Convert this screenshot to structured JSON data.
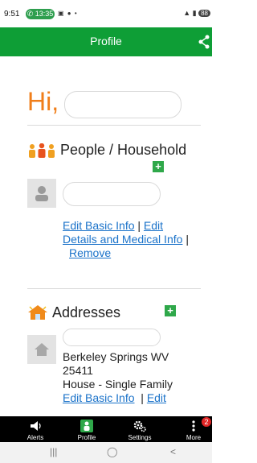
{
  "status_bar": {
    "time": "9:51",
    "call_time": "13:35",
    "battery": "88"
  },
  "header": {
    "title": "Profile"
  },
  "greeting": "Hi,",
  "household": {
    "title": "People / Household",
    "links": {
      "edit_basic": "Edit Basic Info",
      "sep1": "|",
      "edit_details_1": "Edit",
      "edit_details_2": "Details and Medical Info",
      "sep2": "|",
      "remove": "Remove"
    }
  },
  "addresses": {
    "title": "Addresses",
    "city_line": "Berkeley Springs WV",
    "zip": "25411",
    "type": "House - Single Family",
    "links": {
      "edit_basic": "Edit Basic Info",
      "sep": "|",
      "edit": "Edit"
    }
  },
  "nav": {
    "items": [
      {
        "label": "Alerts"
      },
      {
        "label": "Profile"
      },
      {
        "label": "Settings"
      },
      {
        "label": "More",
        "badge": "2"
      }
    ],
    "active_color": "#2fa84a"
  },
  "system_nav": {
    "recents": "|||",
    "home": "◯",
    "back": "<"
  },
  "colors": {
    "brand_green": "#0e9e36",
    "accent_orange": "#f07e1a",
    "link_blue": "#1a72c9"
  }
}
